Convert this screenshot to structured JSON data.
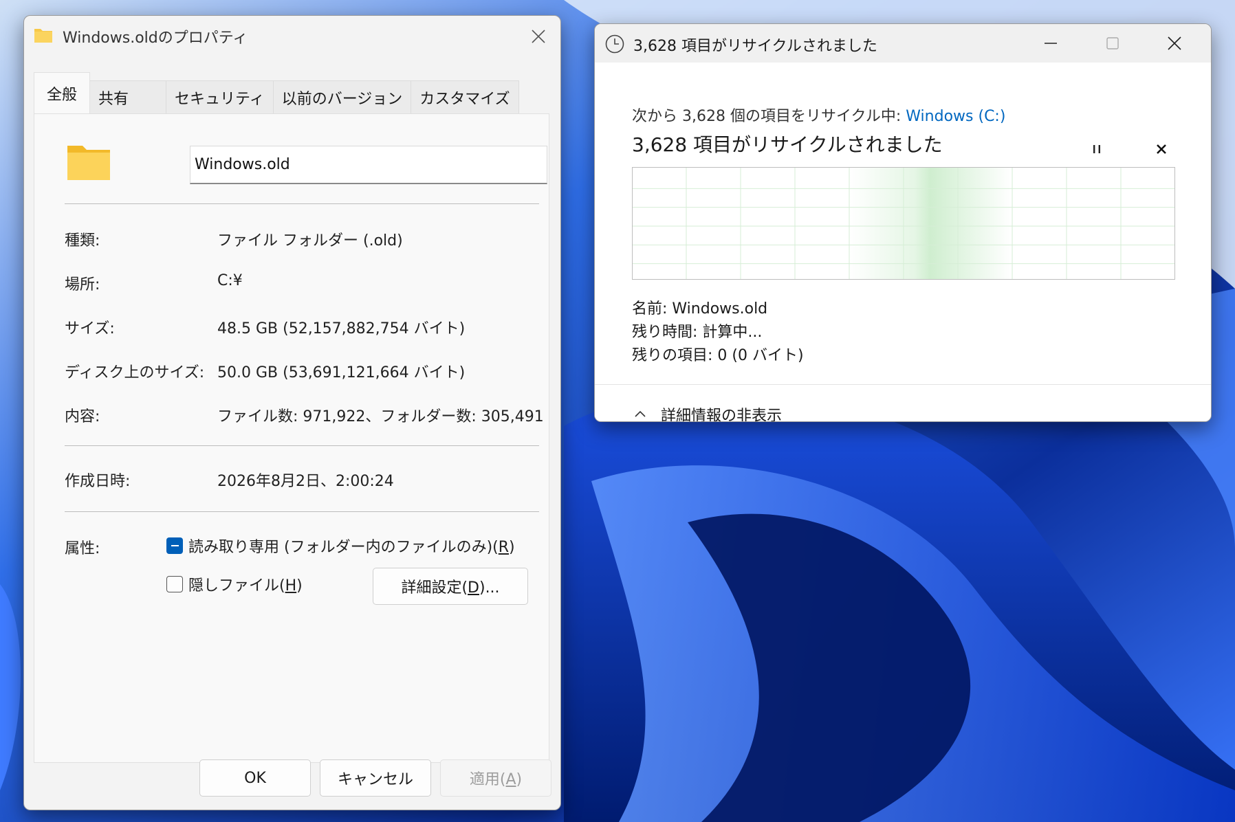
{
  "properties": {
    "title": "Windows.oldのプロパティ",
    "tabs": [
      {
        "label": "全般"
      },
      {
        "label": "共有"
      },
      {
        "label": "セキュリティ"
      },
      {
        "label": "以前のバージョン"
      },
      {
        "label": "カスタマイズ"
      }
    ],
    "name_value": "Windows.old",
    "rows": {
      "type_label": "種類:",
      "type_value": "ファイル フォルダー (.old)",
      "location_label": "場所:",
      "location_value": "C:¥",
      "size_label": "サイズ:",
      "size_value": "48.5 GB (52,157,882,754 バイト)",
      "disk_size_label": "ディスク上のサイズ:",
      "disk_size_value": "50.0 GB (53,691,121,664 バイト)",
      "contents_label": "内容:",
      "contents_value": "ファイル数: 971,922、フォルダー数: 305,491",
      "created_label": "作成日時:",
      "created_value": "2026年8月2日、2:00:24",
      "attributes_label": "属性:"
    },
    "readonly_label": "読み取り専用 (フォルダー内のファイルのみ)(",
    "readonly_key": "R",
    "hidden_label": "隠しファイル(",
    "hidden_key": "H",
    "advanced_label": "詳細設定(",
    "advanced_key": "D",
    "advanced_suffix": ")...",
    "ok_label": "OK",
    "cancel_label": "キャンセル",
    "apply_label": "適用(",
    "apply_key": "A",
    "close_paren": ")"
  },
  "progress": {
    "title": "3,628 項目がリサイクルされました",
    "from_prefix": "次から 3,628 個の項目をリサイクル中: ",
    "from_link": "Windows (C:)",
    "status": "3,628 項目がリサイクルされました",
    "name_line": "名前: Windows.old",
    "time_line": "残り時間: 計算中...",
    "items_line": "残りの項目: 0 (0 バイト)",
    "details_toggle": "詳細情報の非表示",
    "graph_fill_fraction": 1.0
  },
  "colors": {
    "accent": "#005fb8",
    "link": "#0067c0",
    "graph_green": "#c6ebc6",
    "folder_yellow": "#f7c948"
  },
  "icons": {
    "folder": "folder-icon",
    "clock": "clock-icon",
    "close": "close-icon",
    "minimize": "minimize-icon",
    "maximize": "maximize-icon",
    "pause": "pause-icon",
    "stop": "stop-icon",
    "chevron": "chevron-up-icon"
  }
}
